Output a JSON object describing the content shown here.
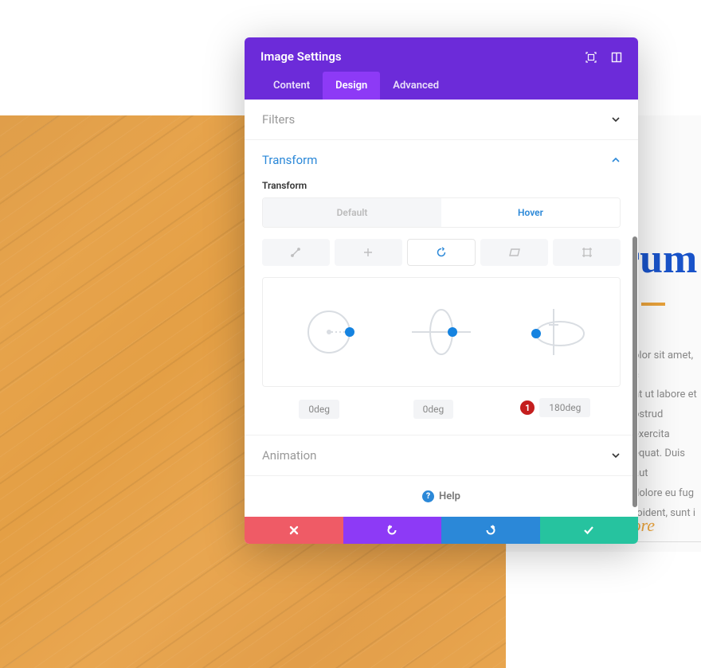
{
  "modal": {
    "title": "Image Settings",
    "tabs": {
      "content": "Content",
      "design": "Design",
      "advanced": "Advanced"
    }
  },
  "sections": {
    "filters": "Filters",
    "transform": "Transform",
    "animation": "Animation"
  },
  "transform": {
    "label": "Transform",
    "states": {
      "default": "Default",
      "hover": "Hover"
    },
    "values": {
      "rotateZ": "0deg",
      "rotateX": "0deg",
      "rotateY": "180deg"
    },
    "annotation": "1"
  },
  "help": "Help",
  "bg": {
    "title": "rum",
    "text": "olor sit amet, c\nnt ut labore et\nostrud exercita\nequat. Duis aut\n dolore eu fug\nroident, sunt i",
    "ore": "ore"
  },
  "colors": {
    "purple": "#6c2bd9",
    "purpleLight": "#8d3af6",
    "blue": "#2b88d8",
    "green": "#26c39f",
    "red": "#ef5b66",
    "annotationRed": "#c41e1e"
  }
}
